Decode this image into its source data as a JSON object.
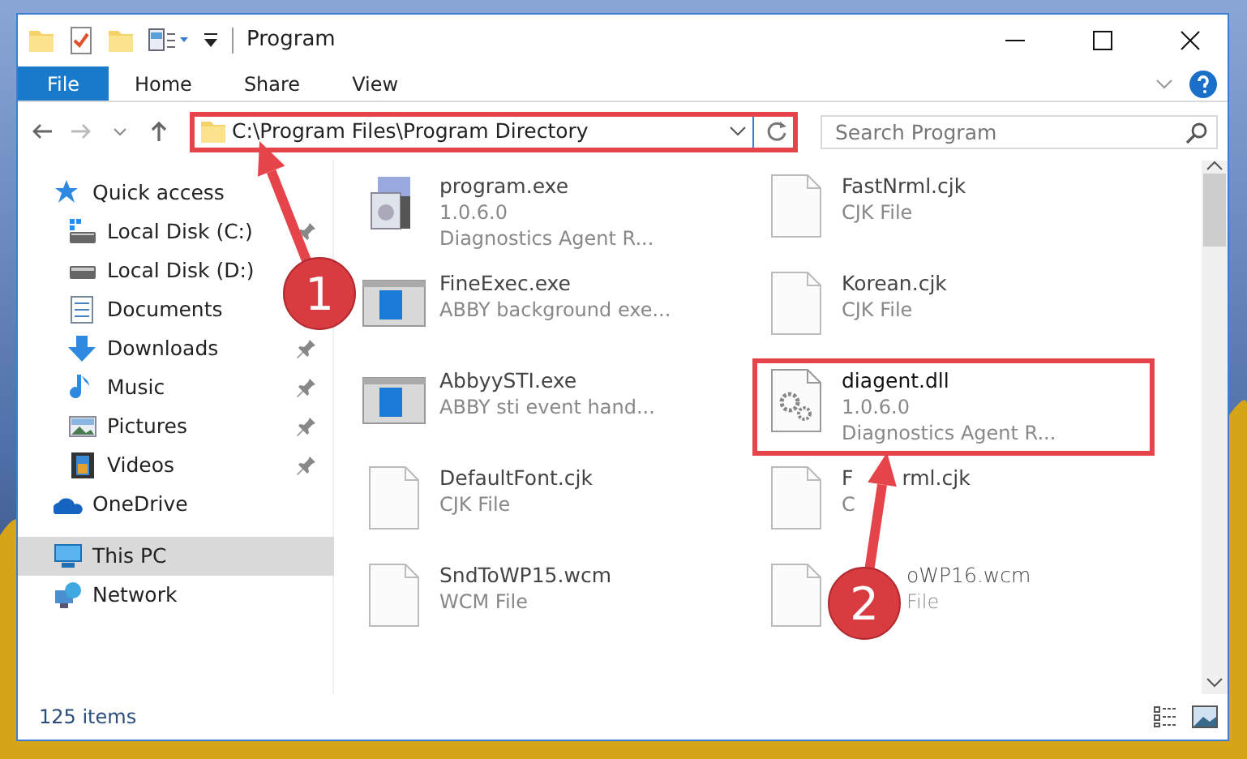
{
  "window": {
    "title": "Program"
  },
  "ribbon_tabs": [
    {
      "label": "File",
      "kind": "file"
    },
    {
      "label": "Home",
      "kind": "tab"
    },
    {
      "label": "Share",
      "kind": "tab"
    },
    {
      "label": "View",
      "kind": "tab"
    }
  ],
  "address": {
    "path": "C:\\Program Files\\Program Directory",
    "highlighted": true
  },
  "search": {
    "placeholder": "Search Program"
  },
  "nav": [
    {
      "label": "Quick access",
      "selected": false,
      "children": [
        {
          "label": "Local Disk (C:)",
          "pinned": true,
          "selected": false
        },
        {
          "label": "Local Disk (D:)",
          "pinned": false,
          "selected": false
        },
        {
          "label": "Documents",
          "pinned": false,
          "selected": false
        },
        {
          "label": "Downloads",
          "pinned": true,
          "selected": false
        },
        {
          "label": "Music",
          "pinned": true,
          "selected": false
        },
        {
          "label": "Pictures",
          "pinned": true,
          "selected": false
        },
        {
          "label": "Videos",
          "pinned": true,
          "selected": false
        }
      ]
    },
    {
      "label": "OneDrive",
      "selected": false
    },
    {
      "label": "This PC",
      "selected": true
    },
    {
      "label": "Network",
      "selected": false
    }
  ],
  "files": [
    {
      "name": [
        "program.exe"
      ],
      "details": [
        [
          "1.0.6.0"
        ],
        [
          "Diagnostics Agent R..."
        ]
      ],
      "highlighted": false
    },
    {
      "name": [
        "FastNrml.cjk"
      ],
      "details": [
        [
          "CJK File"
        ]
      ],
      "highlighted": false
    },
    {
      "name": [
        "FineExec.exe"
      ],
      "details": [
        [
          "ABBY background exe..."
        ]
      ],
      "highlighted": false
    },
    {
      "name": [
        "Korean.cjk"
      ],
      "details": [
        [
          "CJK File"
        ]
      ],
      "highlighted": false
    },
    {
      "name": [
        "AbbyySTI.exe"
      ],
      "details": [
        [
          "ABBY sti event hand..."
        ]
      ],
      "highlighted": false
    },
    {
      "name": [
        "diagent.dll"
      ],
      "details": [
        [
          "1.0.6.0"
        ],
        [
          "Diagnostics Agent R..."
        ]
      ],
      "highlighted": true
    },
    {
      "name": [
        "DefaultFont.cjk"
      ],
      "details": [
        [
          "CJK File"
        ]
      ],
      "highlighted": false
    },
    {
      "name": [
        "F",
        "rml.cjk"
      ],
      "details": [
        [
          "C"
        ]
      ],
      "highlighted": false
    },
    {
      "name": [
        "SndToWP15.wcm"
      ],
      "details": [
        [
          "WCM File"
        ]
      ],
      "highlighted": false
    },
    {
      "name": [
        "oWP16.wcm"
      ],
      "details": [
        [
          "File"
        ]
      ],
      "highlighted": false
    }
  ],
  "status_bar": {
    "count": "125 items"
  },
  "annotations": [
    {
      "number": "1"
    },
    {
      "number": "2"
    }
  ]
}
